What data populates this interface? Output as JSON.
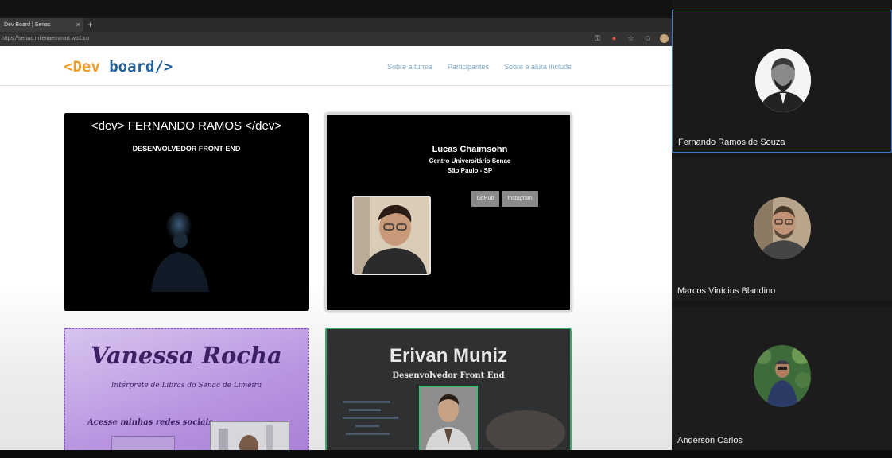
{
  "browser": {
    "tab_title": "Dev Board | Senac",
    "tab_close": "×",
    "new_tab": "+",
    "url": "https://senac.milenaemmart.wp1.co"
  },
  "site": {
    "logo_open": "<Dev",
    "logo_close": "board/>",
    "nav": [
      "Sobre a turma",
      "Participantes",
      "Sobre a alura include"
    ]
  },
  "cards": {
    "fernando": {
      "title": "<dev> FERNANDO RAMOS </dev>",
      "subtitle": "DESENVOLVEDOR FRONT-END"
    },
    "lucas": {
      "name": "Lucas Chaimsohn",
      "university": "Centro Universitário Senac",
      "city": "São Paulo - SP",
      "btn_github": "GitHub",
      "btn_instagram": "Instagram"
    },
    "vanessa": {
      "name": "Vanessa Rocha",
      "role": "Intérprete de Libras do Senac de Limeira",
      "social": "Acesse minhas redes sociais:"
    },
    "erivan": {
      "name": "Erivan Muniz",
      "role": "Desenvolvedor Front End"
    }
  },
  "participants": [
    {
      "name": "Fernando Ramos de Souza",
      "active": true
    },
    {
      "name": "Marcos Vinícius Blandino",
      "active": false
    },
    {
      "name": "Anderson Carlos",
      "active": false
    }
  ],
  "colors": {
    "logo_orange": "#f39c2a",
    "logo_blue": "#1f5f9a",
    "active_speaker_border": "#3a7bd5",
    "card_vanessa": "#b894e0",
    "card_erivan_border": "#39a86b"
  }
}
